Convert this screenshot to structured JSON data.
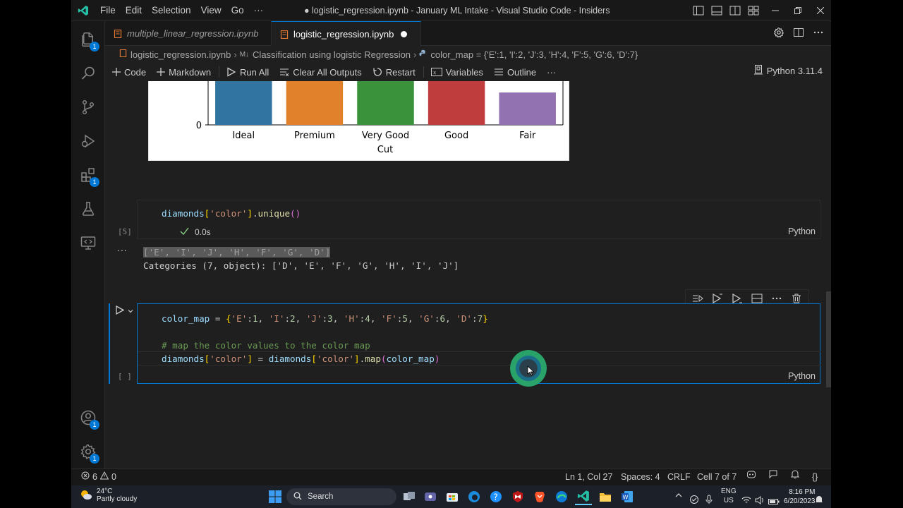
{
  "window": {
    "title": "● logistic_regression.ipynb - January ML Intake - Visual Studio Code - Insiders",
    "menu": [
      "File",
      "Edit",
      "Selection",
      "View",
      "Go",
      "···"
    ]
  },
  "activity": {
    "badges": {
      "explorer": "1",
      "extensions": "1",
      "accounts": "1",
      "manage": "1"
    }
  },
  "tabs": [
    {
      "label": "multiple_linear_regression.ipynb",
      "active": false
    },
    {
      "label": "logistic_regression.ipynb",
      "active": true,
      "dirty": true
    }
  ],
  "breadcrumb": {
    "file": "logistic_regression.ipynb",
    "section": "Classification using logistic Regression",
    "section_prefix": "M↓",
    "symbol": "color_map = {'E':1, 'I':2, 'J':3, 'H':4, 'F':5, 'G':6, 'D':7}"
  },
  "toolbar": {
    "code": "Code",
    "markdown": "Markdown",
    "run_all": "Run All",
    "clear_outputs": "Clear All Outputs",
    "restart": "Restart",
    "variables": "Variables",
    "outline": "Outline",
    "more": "···",
    "kernel": "Python 3.11.4"
  },
  "chart_data": {
    "type": "bar",
    "categories": [
      "Ideal",
      "Premium",
      "Very Good",
      "Good",
      "Fair"
    ],
    "xlabel": "Cut",
    "ytick_visible": "0",
    "colors": [
      "#3274a1",
      "#e1812c",
      "#3a923a",
      "#c03d3e",
      "#9372b2"
    ],
    "values_relative": [
      1.0,
      1.0,
      1.0,
      1.0,
      0.45
    ]
  },
  "cell5": {
    "code": "diamonds['color'].unique()",
    "exec_count": "[5]",
    "time": "0.0s",
    "language": "Python",
    "output_line1": "['E', 'I', 'J', 'H', 'F', 'G', 'D']",
    "output_line2": "Categories (7, object): ['D', 'E', 'F', 'G', 'H', 'I', 'J']",
    "output_menu": "···"
  },
  "cell7": {
    "line1": "color_map = {'E':1, 'I':2, 'J':3, 'H':4, 'F':5, 'G':6, 'D':7}",
    "comment": "# map the color values to the color map",
    "line3": "diamonds['color'] = diamonds['color'].map(color_map)",
    "exec_count": "[ ]",
    "language": "Python"
  },
  "statusbar": {
    "errors": "6",
    "warnings": "0",
    "position": "Ln 1, Col 27",
    "spaces": "Spaces: 4",
    "eol": "CRLF",
    "cell": "Cell 7 of 7",
    "braces": "{}"
  },
  "taskbar": {
    "temp": "24°C",
    "weather": "Partly cloudy",
    "search": "Search",
    "lang1": "ENG",
    "lang2": "US",
    "time": "8:16 PM",
    "date": "6/20/2023"
  }
}
